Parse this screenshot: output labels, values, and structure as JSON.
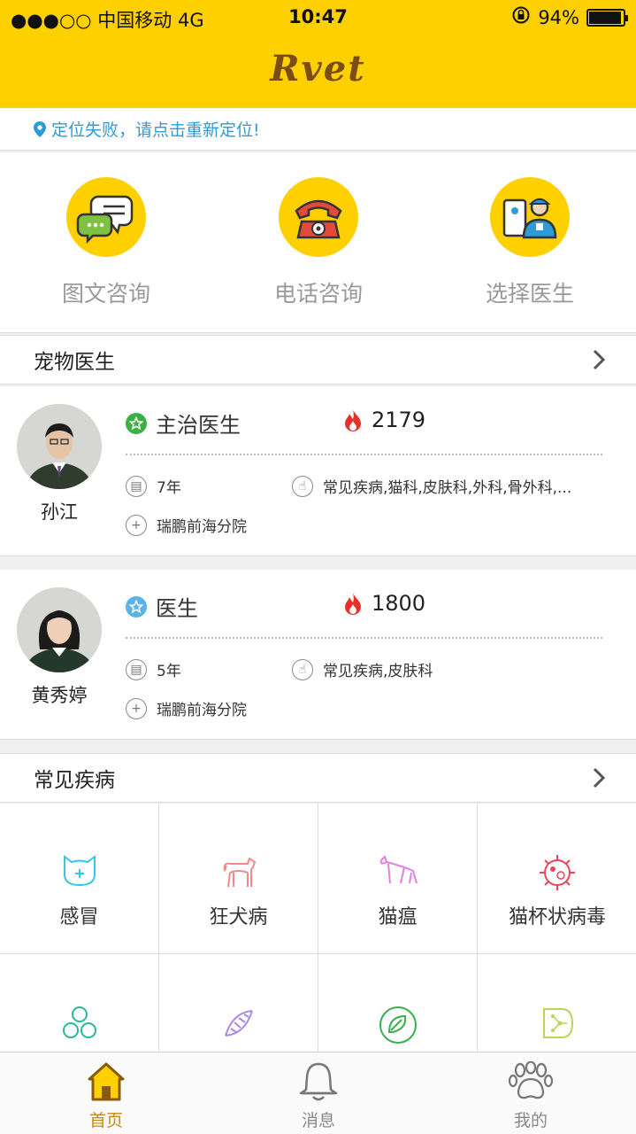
{
  "status_bar": {
    "carrier": "●●●○○ 中国移动  4G",
    "time": "10:47",
    "battery": "94%",
    "battery_level": 0.94
  },
  "header": {
    "logo": "Rvet"
  },
  "location": {
    "message": "定位失败，请点击重新定位!"
  },
  "quick_actions": [
    {
      "label": "图文咨询",
      "icon": "chat-bubbles-icon"
    },
    {
      "label": "电话咨询",
      "icon": "telephone-icon"
    },
    {
      "label": "选择医生",
      "icon": "doctor-icon"
    }
  ],
  "doctors_section": {
    "title": "宠物医生"
  },
  "doctors": [
    {
      "name": "孙江",
      "title": "主治医生",
      "badge_color": "#3cb043",
      "popularity": "2179",
      "experience": "7年",
      "specialties": "常见疾病,猫科,皮肤科,外科,骨外科,...",
      "hospital": "瑞鹏前海分院"
    },
    {
      "name": "黄秀婷",
      "title": "医生",
      "badge_color": "#5ab4ea",
      "popularity": "1800",
      "experience": "5年",
      "specialties": "常见疾病,皮肤科",
      "hospital": "瑞鹏前海分院"
    }
  ],
  "diseases_section": {
    "title": "常见疾病"
  },
  "diseases": [
    {
      "label": "感冒",
      "icon": "cat-face-icon",
      "color": "#36c6e6"
    },
    {
      "label": "狂犬病",
      "icon": "dog-icon",
      "color": "#f08a8a"
    },
    {
      "label": "猫瘟",
      "icon": "cat-icon",
      "color": "#e57fe0"
    },
    {
      "label": "猫杯状病毒",
      "icon": "virus-icon",
      "color": "#e5475c"
    },
    {
      "label": "",
      "icon": "cells-icon",
      "color": "#2bb89a"
    },
    {
      "label": "",
      "icon": "dna-icon",
      "color": "#a98be6"
    },
    {
      "label": "",
      "icon": "leaf-icon",
      "color": "#35b24e"
    },
    {
      "label": "",
      "icon": "shield-network-icon",
      "color": "#b7d65a"
    }
  ],
  "tabbar": [
    {
      "label": "首页",
      "icon": "home-icon",
      "active": true
    },
    {
      "label": "消息",
      "icon": "bell-icon",
      "active": false
    },
    {
      "label": "我的",
      "icon": "paw-icon",
      "active": false
    }
  ],
  "colors": {
    "brand": "#ffd000",
    "active_tab": "#c78a12",
    "link": "#2f9bd6"
  }
}
